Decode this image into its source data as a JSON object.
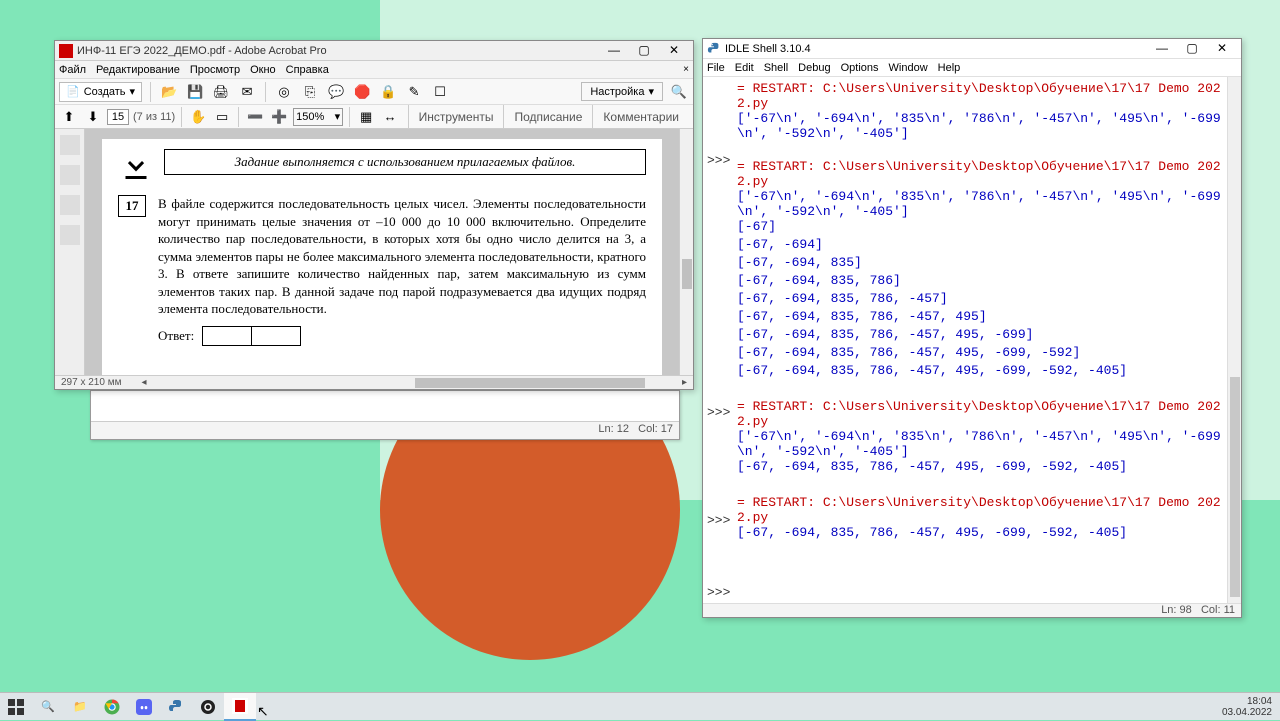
{
  "desktop": {},
  "acrobat": {
    "title": "ИНФ-11 ЕГЭ 2022_ДЕМО.pdf - Adobe Acrobat Pro",
    "menu": [
      "Файл",
      "Редактирование",
      "Просмотр",
      "Окно",
      "Справка"
    ],
    "create_label": "Создать",
    "settings_label": "Настройка",
    "page_current": "15",
    "page_total": "(7 из 11)",
    "zoom": "150%",
    "rtabs": [
      "Инструменты",
      "Подписание",
      "Комментарии"
    ],
    "page_size": "297 x 210 мм",
    "task": {
      "banner": "Задание выполняется с использованием прилагаемых файлов.",
      "number": "17",
      "text": "В файле содержится последовательность целых чисел. Элементы последовательности могут принимать целые значения от –10 000 до 10 000 включительно. Определите количество пар последовательности, в которых хотя бы одно число делится на 3, а сумма элементов пары не более максимального элемента последовательности, кратного 3. В ответе запишите количество найденных пар, затем максимальную из сумм элементов таких пар. В данной задаче под парой подразумевается два идущих подряд элемента последовательности.",
      "answer_label": "Ответ:"
    }
  },
  "editor_status": {
    "ln": "Ln: 12",
    "col": "Col: 17"
  },
  "idle": {
    "title": "IDLE Shell 3.10.4",
    "menu": [
      "File",
      "Edit",
      "Shell",
      "Debug",
      "Options",
      "Window",
      "Help"
    ],
    "status": {
      "ln": "Ln: 98",
      "col": "Col: 11"
    },
    "prompt": ">>>",
    "lines": [
      {
        "cls": "red",
        "t": "= RESTART: C:\\Users\\University\\Desktop\\Обучение\\17\\17 Demo 2022.py"
      },
      {
        "cls": "blue",
        "t": "['-67\\n', '-694\\n', '835\\n', '786\\n', '-457\\n', '495\\n', '-699\\n', '-592\\n', '-405']"
      },
      {
        "cls": "",
        "t": "",
        "prompt": true
      },
      {
        "cls": "red",
        "t": "= RESTART: C:\\Users\\University\\Desktop\\Обучение\\17\\17 Demo 2022.py"
      },
      {
        "cls": "blue",
        "t": "['-67\\n', '-694\\n', '835\\n', '786\\n', '-457\\n', '495\\n', '-699\\n', '-592\\n', '-405']"
      },
      {
        "cls": "blue",
        "t": "[-67]"
      },
      {
        "cls": "blue",
        "t": "[-67, -694]"
      },
      {
        "cls": "blue",
        "t": "[-67, -694, 835]"
      },
      {
        "cls": "blue",
        "t": "[-67, -694, 835, 786]"
      },
      {
        "cls": "blue",
        "t": "[-67, -694, 835, 786, -457]"
      },
      {
        "cls": "blue",
        "t": "[-67, -694, 835, 786, -457, 495]"
      },
      {
        "cls": "blue",
        "t": "[-67, -694, 835, 786, -457, 495, -699]"
      },
      {
        "cls": "blue",
        "t": "[-67, -694, 835, 786, -457, 495, -699, -592]"
      },
      {
        "cls": "blue",
        "t": "[-67, -694, 835, 786, -457, 495, -699, -592, -405]"
      },
      {
        "cls": "",
        "t": "",
        "prompt": true
      },
      {
        "cls": "red",
        "t": "= RESTART: C:\\Users\\University\\Desktop\\Обучение\\17\\17 Demo 2022.py"
      },
      {
        "cls": "blue",
        "t": "['-67\\n', '-694\\n', '835\\n', '786\\n', '-457\\n', '495\\n', '-699\\n', '-592\\n', '-405']"
      },
      {
        "cls": "blue",
        "t": "[-67, -694, 835, 786, -457, 495, -699, -592, -405]"
      },
      {
        "cls": "",
        "t": "",
        "prompt": true
      },
      {
        "cls": "red",
        "t": "= RESTART: C:\\Users\\University\\Desktop\\Обучение\\17\\17 Demo 2022.py"
      },
      {
        "cls": "blue",
        "t": "[-67, -694, 835, 786, -457, 495, -699, -592, -405]"
      },
      {
        "cls": "",
        "t": "",
        "prompt": true
      }
    ]
  },
  "taskbar": {
    "time": "18:04",
    "date": "03.04.2022"
  }
}
